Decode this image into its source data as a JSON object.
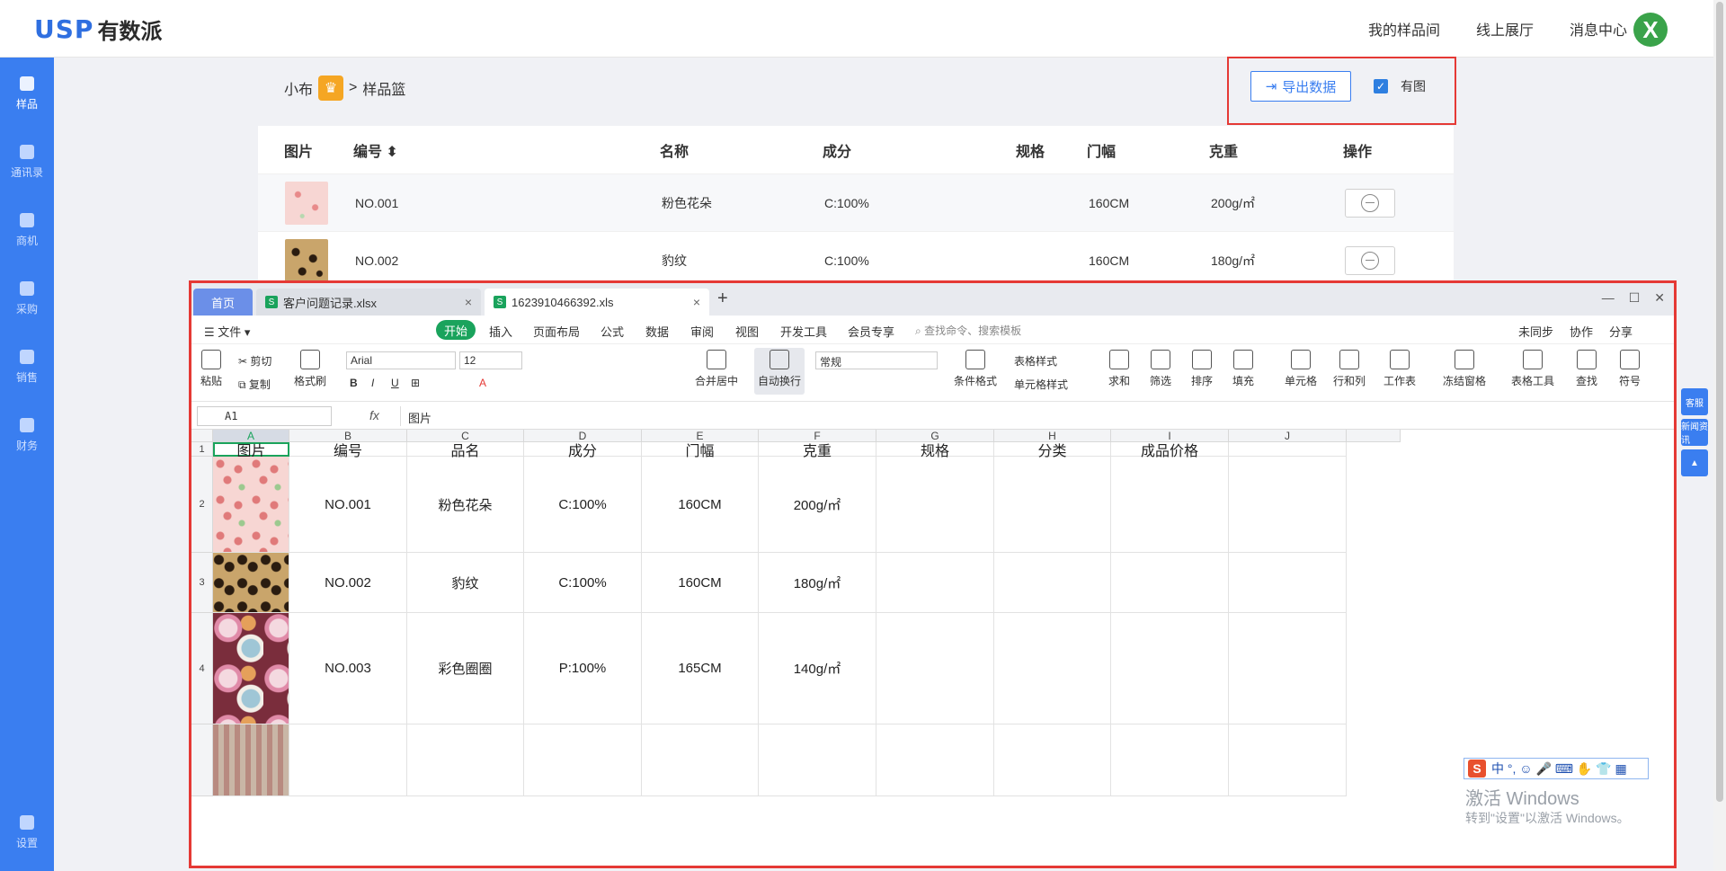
{
  "header": {
    "logo_mark": "USP",
    "logo_text": "有数派",
    "nav": [
      "我的样品间",
      "线上展厅",
      "消息中心"
    ],
    "avatar_letter": "X"
  },
  "sidebar": {
    "items": [
      {
        "label": "样品",
        "active": true
      },
      {
        "label": "通讯录"
      },
      {
        "label": "商机"
      },
      {
        "label": "采购"
      },
      {
        "label": "销售"
      },
      {
        "label": "财务"
      }
    ],
    "bottom": "设置"
  },
  "breadcrumb": {
    "user": "小布",
    "sep": ">",
    "page": "样品篮"
  },
  "actions": {
    "export_label": "导出数据",
    "with_image_label": "有图",
    "with_image_checked": true
  },
  "sample_table": {
    "columns": [
      "图片",
      "编号",
      "名称",
      "成分",
      "规格",
      "门幅",
      "克重",
      "操作"
    ],
    "sort_indicator": "⬍",
    "rows": [
      {
        "code": "NO.001",
        "name": "粉色花朵",
        "composition": "C:100%",
        "spec": "",
        "width": "160CM",
        "weight": "200g/㎡"
      },
      {
        "code": "NO.002",
        "name": "豹纹",
        "composition": "C:100%",
        "spec": "",
        "width": "160CM",
        "weight": "180g/㎡"
      }
    ]
  },
  "spreadsheet": {
    "tabs": {
      "home": "首页",
      "file1": "客户问题记录.xlsx",
      "file2": "1623910466392.xls"
    },
    "menu": [
      "文件",
      "开始",
      "插入",
      "页面布局",
      "公式",
      "数据",
      "审阅",
      "视图",
      "开发工具",
      "会员专享"
    ],
    "search_placeholder": "查找命令、搜索模板",
    "menu_right": [
      "未同步",
      "协作",
      "分享"
    ],
    "ribbon": {
      "paste": "粘贴",
      "cut": "剪切",
      "copy": "复制",
      "format_painter": "格式刷",
      "font": "Arial",
      "font_size": "12",
      "merge": "合并居中",
      "wrap": "自动换行",
      "number_format": "常规",
      "cond_format": "条件格式",
      "table_style": "表格样式",
      "cell_style": "单元格样式",
      "sum": "求和",
      "filter": "筛选",
      "sort": "排序",
      "fill": "填充",
      "cell": "单元格",
      "row_col": "行和列",
      "worksheet": "工作表",
      "freeze": "冻结窗格",
      "table_tools": "表格工具",
      "find": "查找",
      "symbol": "符号"
    },
    "name_box": "A1",
    "fx": "fx",
    "formula_value": "图片",
    "col_letters": [
      "A",
      "B",
      "C",
      "D",
      "E",
      "F",
      "G",
      "H",
      "I",
      "J"
    ],
    "row_numbers": [
      "1",
      "2",
      "3",
      "4"
    ],
    "header_row": [
      "图片",
      "编号",
      "品名",
      "成分",
      "门幅",
      "克重",
      "规格",
      "分类",
      "成品价格",
      ""
    ],
    "rows": [
      [
        "",
        "NO.001",
        "粉色花朵",
        "C:100%",
        "160CM",
        "200g/㎡",
        "",
        "",
        "",
        ""
      ],
      [
        "",
        "NO.002",
        "豹纹",
        "C:100%",
        "160CM",
        "180g/㎡",
        "",
        "",
        "",
        ""
      ],
      [
        "",
        "NO.003",
        "彩色圈圈",
        "P:100%",
        "165CM",
        "140g/㎡",
        "",
        "",
        "",
        ""
      ]
    ]
  },
  "ime": {
    "logo": "S",
    "text": "中 °, ☺ 🎤 ⌨ ✋ 👕 ▦"
  },
  "watermark": {
    "line1": "激活 Windows",
    "line2": "转到\"设置\"以激活 Windows。"
  },
  "float_tabs": [
    "客服",
    "新闻资讯"
  ],
  "colors": {
    "accent": "#3a7ef0",
    "highlight": "#e53935",
    "wps_green": "#1aa35c"
  }
}
